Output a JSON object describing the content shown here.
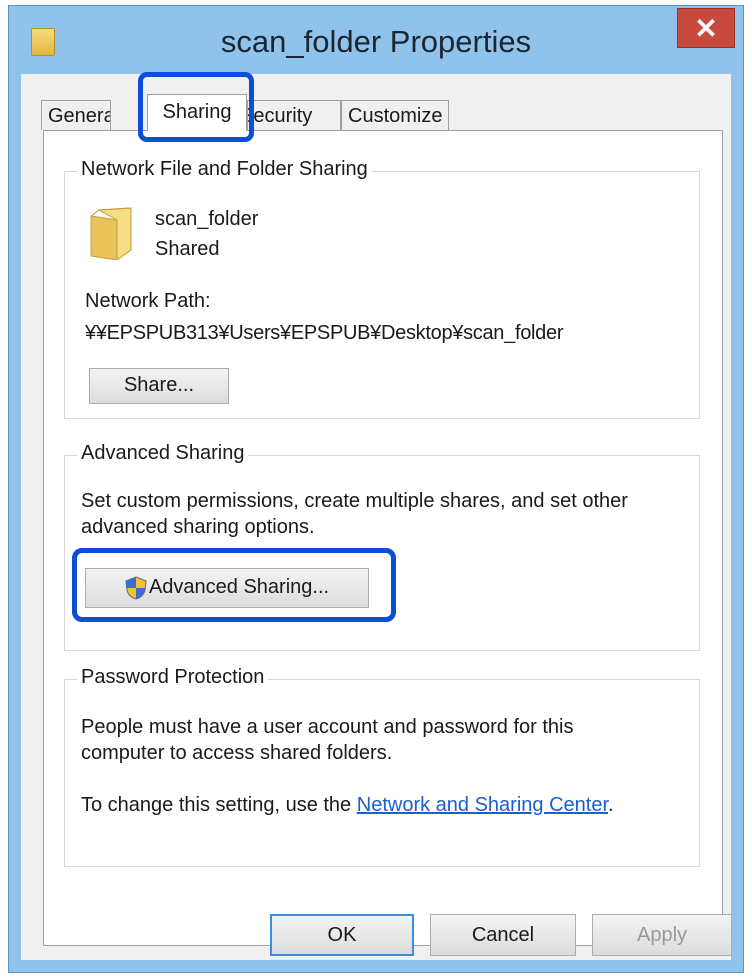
{
  "window": {
    "title": "scan_folder Properties",
    "close_label": "✕"
  },
  "tabs": [
    {
      "label": "General",
      "active": false
    },
    {
      "label": "Sharing",
      "active": true
    },
    {
      "label": "Security",
      "active": false
    },
    {
      "label": "Customize",
      "active": false
    }
  ],
  "network_sharing": {
    "group_title": "Network File and Folder Sharing",
    "folder_name": "scan_folder",
    "folder_status": "Shared",
    "path_label": "Network Path:",
    "path_value": "¥¥EPSPUB313¥Users¥EPSPUB¥Desktop¥scan_folder",
    "share_button": "Share..."
  },
  "advanced_sharing": {
    "group_title": "Advanced Sharing",
    "description_line1": "Set custom permissions, create multiple shares, and set other",
    "description_line2": "advanced sharing options.",
    "button": "Advanced Sharing..."
  },
  "password_protection": {
    "group_title": "Password Protection",
    "description_line1": "People must have a user account and password for this",
    "description_line2": "computer to access shared folders.",
    "change_text": "To change this setting, use the",
    "link_text": "Network and Sharing Center",
    "trailing": "."
  },
  "footer": {
    "ok": "OK",
    "cancel": "Cancel",
    "apply": "Apply"
  },
  "colors": {
    "highlight": "#0a4fd6",
    "titlebar": "#8fc3eb",
    "close": "#c8493d",
    "link": "#1a5fcf"
  }
}
